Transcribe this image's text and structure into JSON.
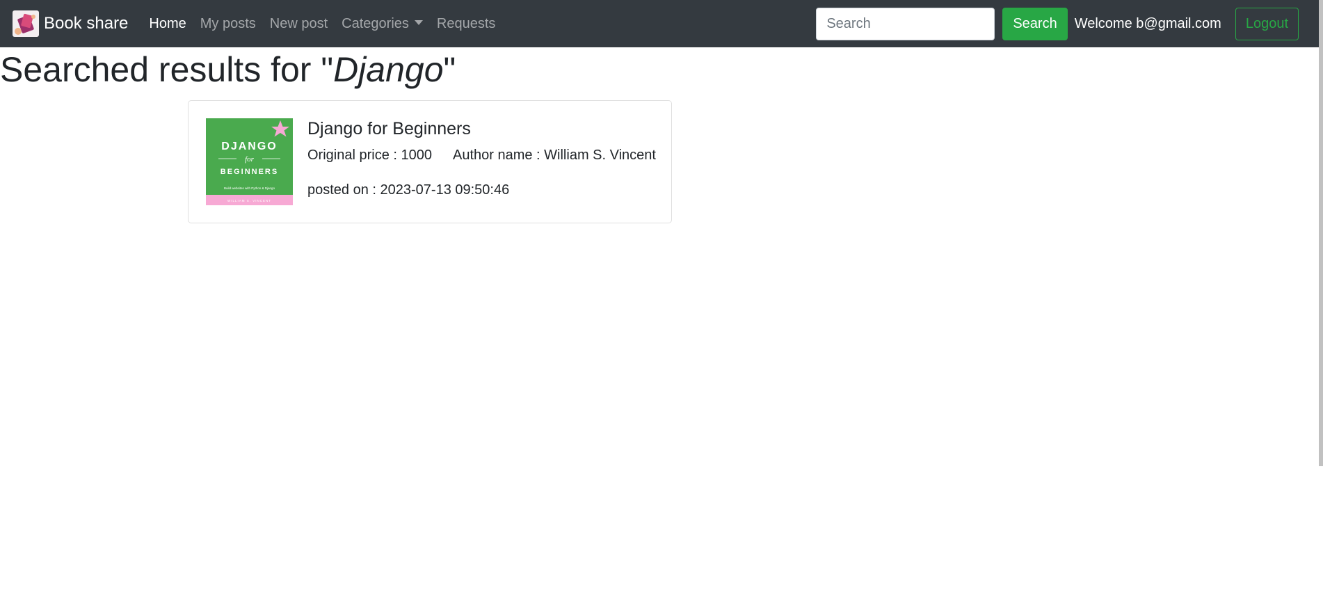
{
  "navbar": {
    "brand": "Book share",
    "links": [
      {
        "label": "Home",
        "active": true
      },
      {
        "label": "My posts",
        "active": false
      },
      {
        "label": "New post",
        "active": false
      },
      {
        "label": "Categories",
        "active": false,
        "dropdown": true
      },
      {
        "label": "Requests",
        "active": false
      }
    ],
    "search_placeholder": "Search",
    "search_button": "Search",
    "welcome": "Welcome b@gmail.com",
    "logout": "Logout"
  },
  "results": {
    "title_prefix": "Searched results for \"",
    "query": "Django",
    "title_suffix": "\"",
    "items": [
      {
        "title": "Django for Beginners",
        "original_price": "Original price : 1000",
        "author": "Author name : William S. Vincent",
        "posted_on": "posted on : 2023-07-13 09:50:46",
        "cover": {
          "line1": "DJANGO",
          "line2": "for",
          "line3": "BEGINNERS",
          "subtitle": "Build websites with Python & Django",
          "author": "WILLIAM S. VINCENT",
          "colors": {
            "background": "#4aaa4e",
            "accent": "#f7a9d4"
          }
        }
      }
    ]
  },
  "colors": {
    "navbar": "#343a40",
    "success": "#28a745"
  }
}
